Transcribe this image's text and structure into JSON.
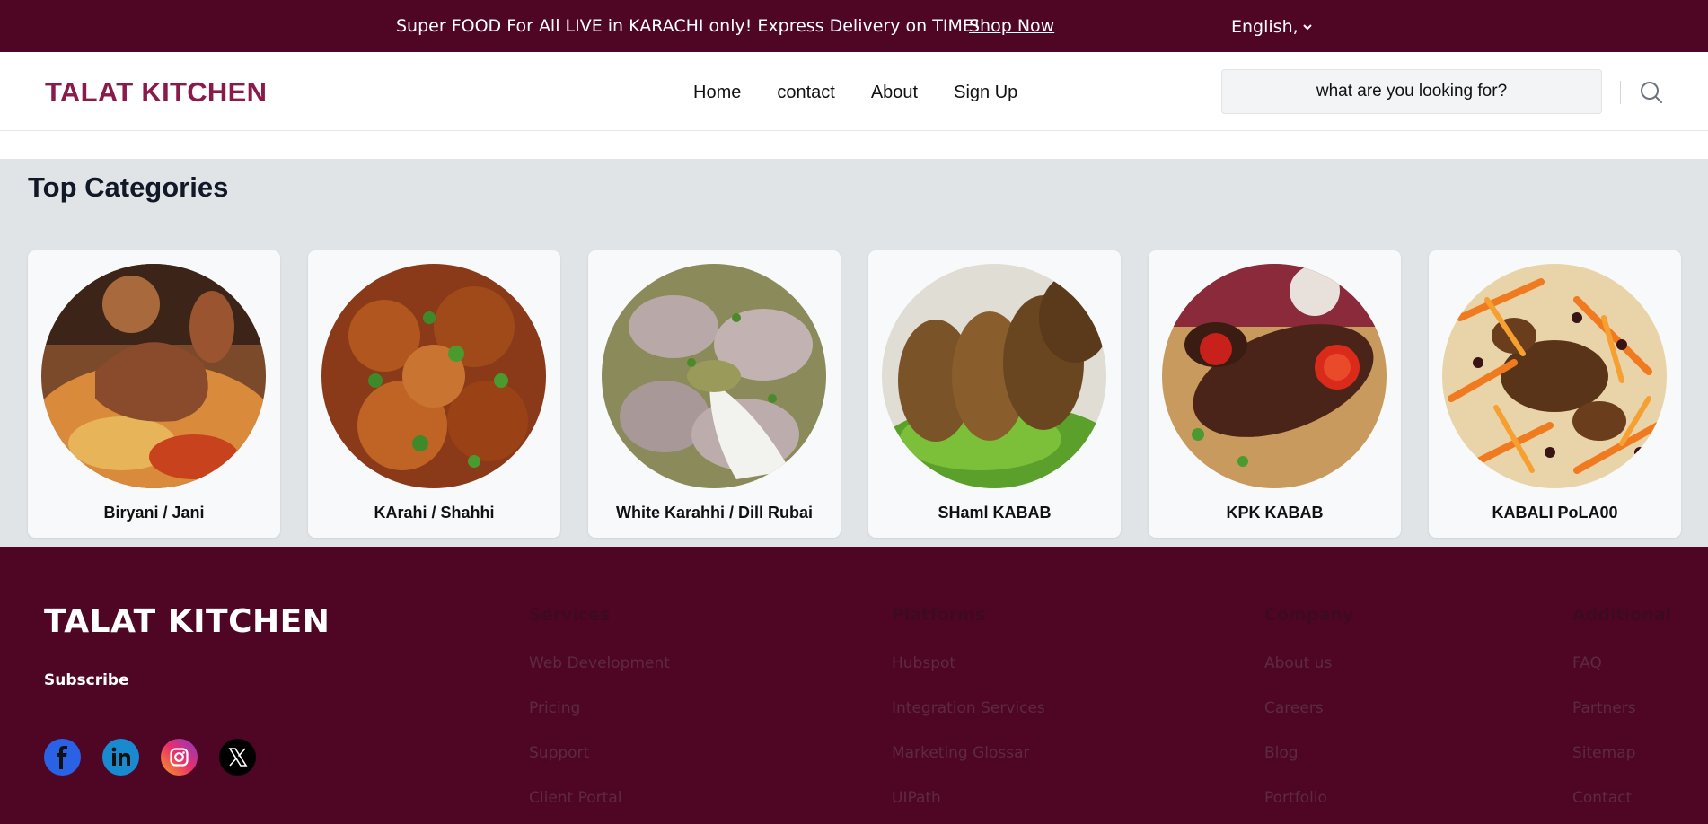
{
  "topbar": {
    "message": "Super FOOD For All LIVE in KARACHI only! Express Delivery on TIME!",
    "shop_label": "Shop Now",
    "language": "English,"
  },
  "header": {
    "logo": "TALAT KITCHEN",
    "nav": [
      "Home",
      "contact",
      "About",
      "Sign Up"
    ],
    "search_placeholder": "what are you looking for?"
  },
  "categories": {
    "title": "Top Categories",
    "items": [
      {
        "name": "Biryani / Jani"
      },
      {
        "name": "KArahi / Shahhi"
      },
      {
        "name": "White Karahhi / Dill Rubai"
      },
      {
        "name": "SHaml KABAB"
      },
      {
        "name": "KPK KABAB"
      },
      {
        "name": "KABALI PoLA00"
      }
    ]
  },
  "footer": {
    "logo": "TALAT KITCHEN",
    "subscribe": "Subscribe",
    "social": [
      "facebook-icon",
      "linkedin-icon",
      "instagram-icon",
      "x-icon"
    ],
    "columns": [
      {
        "heading": "Services",
        "links": [
          "Web Development",
          "Pricing",
          "Support",
          "Client Portal"
        ]
      },
      {
        "heading": "Platforms",
        "links": [
          "Hubspot",
          "Integration Services",
          "Marketing Glossar",
          "UIPath"
        ]
      },
      {
        "heading": "Company",
        "links": [
          "About us",
          "Careers",
          "Blog",
          "Portfolio"
        ]
      },
      {
        "heading": "Additional",
        "links": [
          "FAQ",
          "Partners",
          "Sitemap",
          "Contact"
        ]
      }
    ]
  },
  "colors": {
    "brand_maroon": "#4e0624",
    "logo_color": "#8a1a4a",
    "section_bg": "#e1e4e6"
  }
}
